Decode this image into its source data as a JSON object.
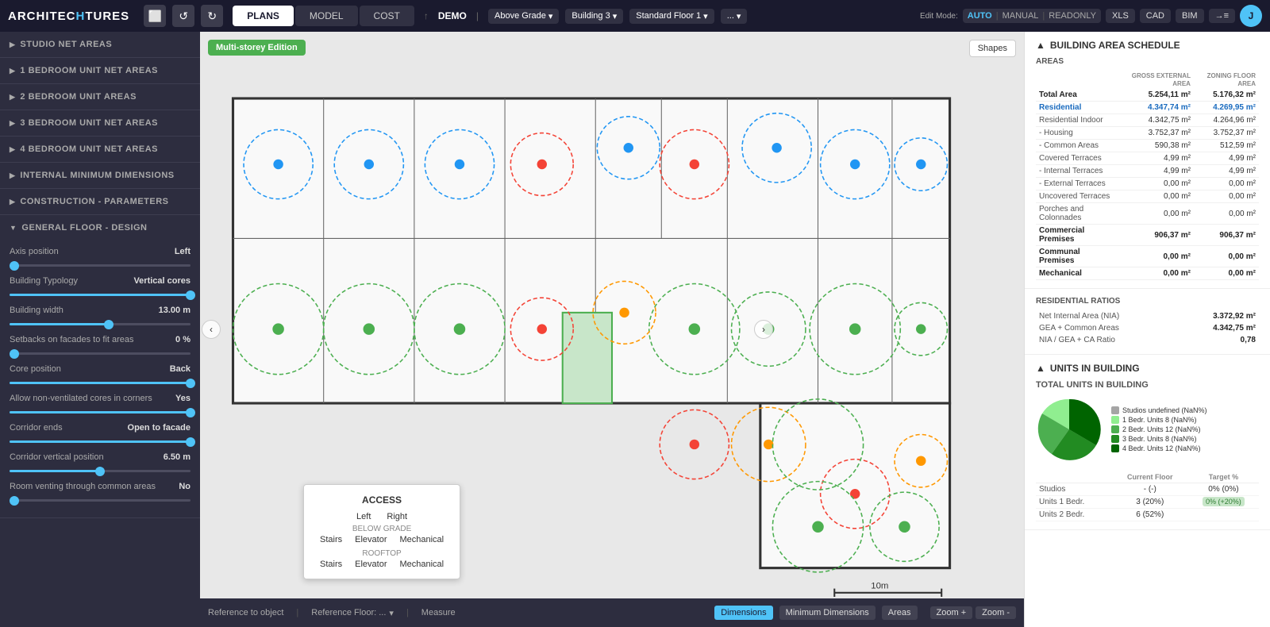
{
  "nav": {
    "logo": "ARCHITECHTURES",
    "tabs": [
      "PLANS",
      "MODEL",
      "COST"
    ],
    "active_tab": "PLANS",
    "demo_label": "DEMO",
    "dropdowns": [
      "Above Grade",
      "Building 3",
      "Standard Floor 1",
      "..."
    ],
    "edit_modes": [
      "AUTO",
      "MANUAL",
      "READONLY"
    ],
    "active_edit": "AUTO",
    "exports": [
      "XLS",
      "CAD",
      "BIM",
      "→≡"
    ],
    "user_initial": "J"
  },
  "left_panel": {
    "sections": [
      {
        "id": "studio",
        "label": "STUDIO NET AREAS",
        "expanded": false
      },
      {
        "id": "1bed",
        "label": "1 BEDROOM UNIT NET AREAS",
        "expanded": false
      },
      {
        "id": "2bed",
        "label": "2 BEDROOM UNIT AREAS",
        "expanded": false
      },
      {
        "id": "3bed",
        "label": "3 BEDROOM UNIT NET AREAS",
        "expanded": false
      },
      {
        "id": "4bed",
        "label": "4 BEDROOM UNIT NET AREAS",
        "expanded": false
      },
      {
        "id": "internal",
        "label": "INTERNAL MINIMUM DIMENSIONS",
        "expanded": false
      },
      {
        "id": "construction",
        "label": "CONSTRUCTION - PARAMETERS",
        "expanded": false
      },
      {
        "id": "general",
        "label": "GENERAL FLOOR - DESIGN",
        "expanded": true
      }
    ],
    "params": [
      {
        "label": "Axis position",
        "value": "Left",
        "type": "slider",
        "percent": 0
      },
      {
        "label": "Building Typology",
        "value": "Vertical cores",
        "type": "slider",
        "percent": 100
      },
      {
        "label": "Building width",
        "value": "13.00  m",
        "type": "slider",
        "percent": 55
      },
      {
        "label": "Setbacks on facades to fit areas",
        "value": "0  %",
        "type": "slider",
        "percent": 0
      },
      {
        "label": "Core position",
        "value": "Back",
        "type": "slider",
        "percent": 100
      },
      {
        "label": "Allow non-ventilated cores in corners",
        "value": "Yes",
        "type": "slider",
        "percent": 100
      },
      {
        "label": "Corridor ends",
        "value": "Open to facade",
        "type": "slider",
        "percent": 100
      },
      {
        "label": "Corridor vertical position",
        "value": "6.50  m",
        "type": "slider",
        "percent": 50
      },
      {
        "label": "Room venting through common areas",
        "value": "No",
        "type": "slider",
        "percent": 0
      }
    ]
  },
  "canvas": {
    "badge": "Multi-storey Edition",
    "shapes_btn": "Shapes",
    "access_popup": {
      "title": "ACCESS",
      "left": "Left",
      "right": "Right",
      "below_grade": "BELOW GRADE",
      "bg_stairs": "Stairs",
      "bg_elevator": "Elevator",
      "bg_mechanical": "Mechanical",
      "rooftop": "ROOFTOP",
      "rt_stairs": "Stairs",
      "rt_elevator": "Elevator",
      "rt_mechanical": "Mechanical"
    },
    "bottom_bar": {
      "reference": "Reference to object",
      "ref_floor": "Reference Floor:  ...",
      "measure": "Measure",
      "dimensions": "Dimensions",
      "min_dimensions": "Minimum Dimensions",
      "areas": "Areas",
      "zoom_in": "Zoom +",
      "zoom_out": "Zoom -",
      "scale": "10m"
    }
  },
  "right_panel": {
    "building_area_title": "BUILDING AREA SCHEDULE",
    "areas_label": "AREAS",
    "col_gross": "GROSS EXTERNAL AREA",
    "col_zoning": "ZONING FLOOR AREA",
    "rows": [
      {
        "label": "Total Area",
        "gross": "5.254,11 m²",
        "zoning": "5.176,32 m²",
        "bold": true
      },
      {
        "label": "Residential",
        "gross": "4.347,74 m²",
        "zoning": "4.269,95 m²",
        "highlight": true
      },
      {
        "label": "Residential Indoor",
        "gross": "4.342,75 m²",
        "zoning": "4.264,96 m²"
      },
      {
        "label": "- Housing",
        "gross": "3.752,37 m²",
        "zoning": "3.752,37 m²"
      },
      {
        "label": "- Common Areas",
        "gross": "590,38 m²",
        "zoning": "512,59 m²"
      },
      {
        "label": "Covered Terraces",
        "gross": "4,99 m²",
        "zoning": "4,99 m²"
      },
      {
        "label": "- Internal Terraces",
        "gross": "4,99 m²",
        "zoning": "4,99 m²"
      },
      {
        "label": "- External Terraces",
        "gross": "0,00 m²",
        "zoning": "0,00 m²"
      },
      {
        "label": "Uncovered Terraces",
        "gross": "0,00 m²",
        "zoning": "0,00 m²"
      },
      {
        "label": "Porches and Colonnades",
        "gross": "0,00 m²",
        "zoning": "0,00 m²"
      },
      {
        "label": "Commercial Premises",
        "gross": "906,37 m²",
        "zoning": "906,37 m²",
        "bold": true
      },
      {
        "label": "Communal Premises",
        "gross": "0,00 m²",
        "zoning": "0,00 m²",
        "bold": true
      },
      {
        "label": "Mechanical",
        "gross": "0,00 m²",
        "zoning": "0,00 m²",
        "bold": true
      }
    ],
    "residential_ratios_title": "RESIDENTIAL RATIOS",
    "ratios": [
      {
        "label": "Net Internal Area (NIA)",
        "value": "3.372,92 m²"
      },
      {
        "label": "GEA + Common Areas",
        "value": "4.342,75 m²"
      },
      {
        "label": "NIA / GEA + CA Ratio",
        "value": "0,78"
      }
    ],
    "units_title": "UNITS IN BUILDING",
    "total_units_title": "TOTAL UNITS IN BUILDING",
    "pie_legend": [
      {
        "label": "Studios undefined (NaN%)",
        "color": "#a5a5a5"
      },
      {
        "label": "1 Bedr. Units 8 (NaN%)",
        "color": "#90EE90"
      },
      {
        "label": "2 Bedr. Units 12 (NaN%)",
        "color": "#4CAF50"
      },
      {
        "label": "3 Bedr. Units 8 (NaN%)",
        "color": "#228B22"
      },
      {
        "label": "4 Bedr. Units 12 (NaN%)",
        "color": "#006400"
      }
    ],
    "units_table": {
      "headers": [
        "",
        "Current Floor",
        "Target %"
      ],
      "rows": [
        {
          "label": "Studios",
          "current": "- (-)",
          "target": "0% (0%)"
        },
        {
          "label": "Units 1 Bedr.",
          "current": "3 (20%)",
          "target": "0% (+20%)",
          "tag": "green"
        },
        {
          "label": "Units 2 Bedr.",
          "current": "6 (52%)",
          "target": ""
        }
      ]
    }
  }
}
